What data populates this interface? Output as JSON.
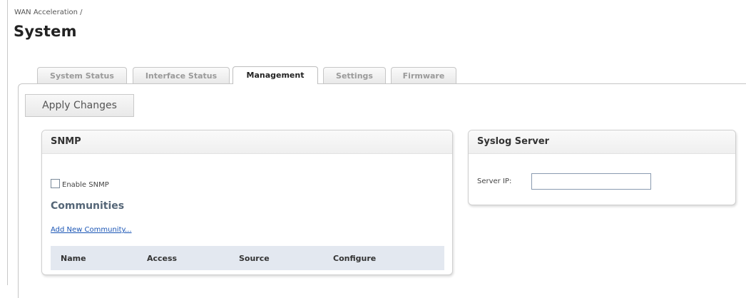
{
  "breadcrumb": "WAN Acceleration /",
  "page_title": "System",
  "tabs": [
    {
      "label": "System Status",
      "active": false
    },
    {
      "label": "Interface Status",
      "active": false
    },
    {
      "label": "Management",
      "active": true
    },
    {
      "label": "Settings",
      "active": false
    },
    {
      "label": "Firmware",
      "active": false
    }
  ],
  "toolbar": {
    "apply_label": "Apply Changes"
  },
  "snmp": {
    "title": "SNMP",
    "enable_label": "Enable SNMP",
    "enable_checked": false,
    "communities_heading": "Communities",
    "add_link": "Add New Community...",
    "table_headers": [
      "Name",
      "Access",
      "Source",
      "Configure"
    ]
  },
  "syslog": {
    "title": "Syslog Server",
    "server_ip_label": "Server IP:",
    "server_ip_value": ""
  }
}
